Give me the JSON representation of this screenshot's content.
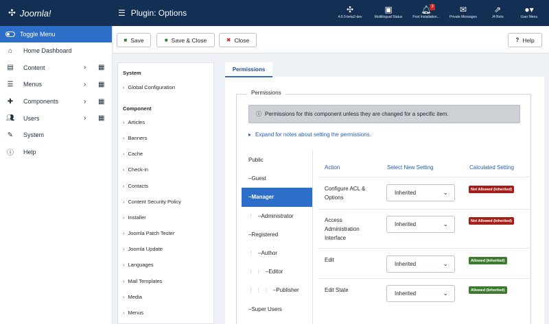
{
  "app": {
    "logo_text": "Joomla!",
    "page_title": "Plugin: Options"
  },
  "topbar_items": [
    {
      "label": "4.0.0-beta2-dev",
      "icon": "joomla-icon"
    },
    {
      "label": "Multilingual Status",
      "icon": "language-icon"
    },
    {
      "label": "Post Installation...",
      "icon": "bell-icon",
      "badge": "3"
    },
    {
      "label": "Private Messages",
      "icon": "envelope-icon"
    },
    {
      "label": "J4 Beta",
      "icon": "external-link-icon"
    },
    {
      "label": "User Menu",
      "icon": "user-icon"
    }
  ],
  "sidebar": {
    "toggle_label": "Toggle Menu",
    "items": [
      {
        "label": "Home Dashboard",
        "icon": "home-icon"
      },
      {
        "label": "Content",
        "icon": "file-icon"
      },
      {
        "label": "Menus",
        "icon": "list-icon"
      },
      {
        "label": "Components",
        "icon": "puzzle-icon"
      },
      {
        "label": "Users",
        "icon": "users-icon"
      },
      {
        "label": "System",
        "icon": "wrench-icon"
      },
      {
        "label": "Help",
        "icon": "info-icon"
      }
    ]
  },
  "toolbar": {
    "save": "Save",
    "save_close": "Save & Close",
    "close": "Close",
    "help": "Help"
  },
  "left_panel": {
    "system_heading": "System",
    "global_config": "Global Configuration",
    "component_heading": "Component",
    "components": [
      "Articles",
      "Banners",
      "Cache",
      "Check-in",
      "Contacts",
      "Content Security Policy",
      "Installer",
      "Joomla Patch Tester",
      "Joomla Update",
      "Languages",
      "Mail Templates",
      "Media",
      "Menus"
    ]
  },
  "tab_label": "Permissions",
  "permissions": {
    "legend": "Permissions",
    "info_text": "Permissions for this component unless they are changed for a specific item.",
    "expand_text": "Expand for notes about setting the permissions.",
    "groups": [
      {
        "label": "Public",
        "prefix": "",
        "dots": ""
      },
      {
        "label": "Guest",
        "prefix": "– ",
        "dots": ""
      },
      {
        "label": "Manager",
        "prefix": "– ",
        "dots": ""
      },
      {
        "label": "Administrator",
        "prefix": "– ",
        "dots": "⋮"
      },
      {
        "label": "Registered",
        "prefix": "– ",
        "dots": ""
      },
      {
        "label": "Author",
        "prefix": "– ",
        "dots": "⋮"
      },
      {
        "label": "Editor",
        "prefix": "– ",
        "dots": "⋮ ⋮"
      },
      {
        "label": "Publisher",
        "prefix": "– ",
        "dots": "⋮ ⋮ ⋮"
      },
      {
        "label": "Super Users",
        "prefix": "– ",
        "dots": ""
      }
    ],
    "active_group": "Manager",
    "headers": {
      "action": "Action",
      "select": "Select New Setting",
      "calculated": "Calculated Setting"
    },
    "rows": [
      {
        "action_lines": [
          "Configure ACL &",
          "Options"
        ],
        "setting": "Inherited",
        "calculated": "Not Allowed (Inherited)",
        "status": "denied"
      },
      {
        "action_lines": [
          "Access",
          "Administration",
          "Interface"
        ],
        "setting": "Inherited",
        "calculated": "Not Allowed (Inherited)",
        "status": "denied"
      },
      {
        "action_lines": [
          "Edit"
        ],
        "setting": "Inherited",
        "calculated": "Allowed (Inherited)",
        "status": "allowed"
      },
      {
        "action_lines": [
          "Edit State"
        ],
        "setting": "Inherited",
        "calculated": "Allowed (Inherited)",
        "status": "allowed"
      }
    ]
  },
  "colors": {
    "header": "#132f53",
    "accent": "#2d6ec8",
    "denied": "#a51f18",
    "allowed": "#3c7a2f"
  }
}
